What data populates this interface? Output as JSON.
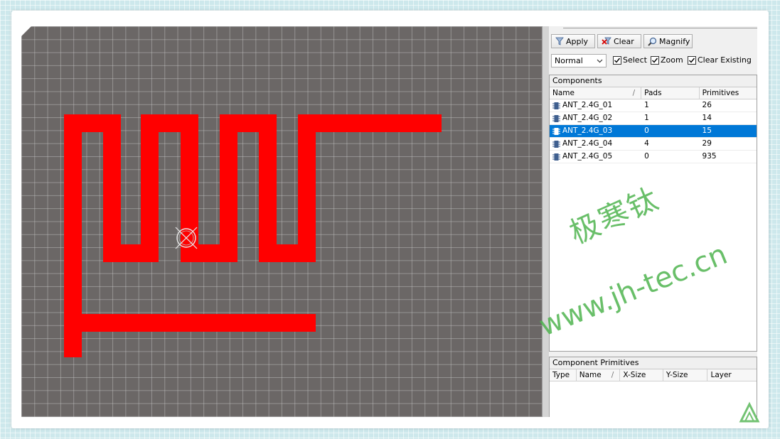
{
  "toolbar": {
    "apply_label": "Apply",
    "clear_label": "Clear",
    "magnify_label": "Magnify",
    "mode_value": "Normal",
    "select_label": "Select",
    "zoom_label": "Zoom",
    "clear_existing_label": "Clear Existing"
  },
  "components": {
    "title": "Components",
    "columns": [
      "Name",
      "Pads",
      "Primitives"
    ],
    "sort_indicator": "/",
    "rows": [
      {
        "name": "ANT_2.4G_01",
        "pads": "1",
        "primitives": "26"
      },
      {
        "name": "ANT_2.4G_02",
        "pads": "1",
        "primitives": "14"
      },
      {
        "name": "ANT_2.4G_03",
        "pads": "0",
        "primitives": "15"
      },
      {
        "name": "ANT_2.4G_04",
        "pads": "4",
        "primitives": "29"
      },
      {
        "name": "ANT_2.4G_05",
        "pads": "0",
        "primitives": "935"
      }
    ],
    "selected_index": 2
  },
  "primitives": {
    "title": "Component Primitives",
    "columns": [
      "Type",
      "Name",
      "X-Size",
      "Y-Size",
      "Layer"
    ],
    "sort_indicator": "/"
  },
  "watermark": {
    "line1": "极寒钛",
    "line2": "www.jh-tec.cn"
  },
  "colors": {
    "trace": "#ff0000",
    "canvas": "#6b6766",
    "selection": "#0078d7",
    "watermark": "#4fb44f"
  },
  "icons": {
    "apply": "funnel-icon",
    "clear": "clear-filter-icon",
    "magnify": "magnifier-icon",
    "component": "chip-icon",
    "origin": "origin-marker-icon"
  }
}
